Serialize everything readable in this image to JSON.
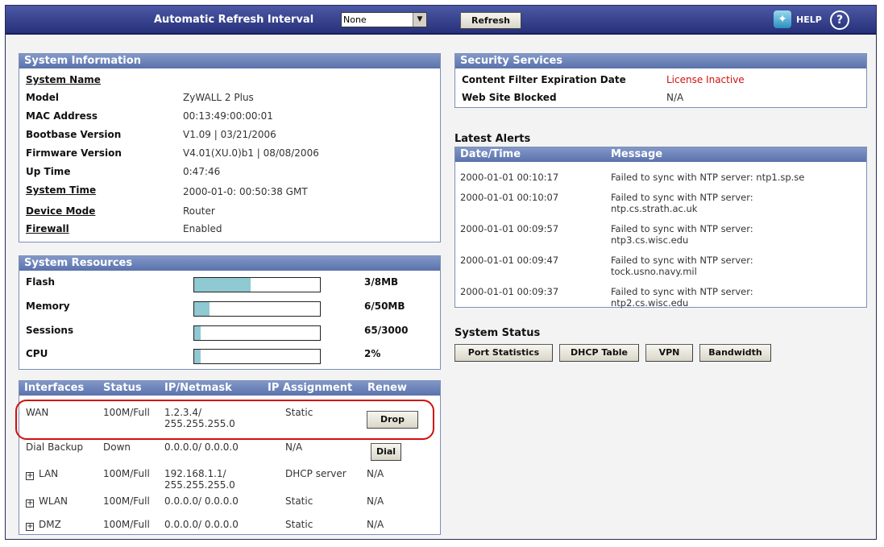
{
  "toolbar": {
    "refresh_interval_label": "Automatic Refresh Interval",
    "refresh_interval_value": "None",
    "refresh_button": "Refresh",
    "help_label": "HELP",
    "help_q": "?"
  },
  "system_information": {
    "title": "System Information",
    "rows": [
      {
        "label": "System Name",
        "value": ""
      },
      {
        "label": "Model",
        "value": "ZyWALL 2 Plus"
      },
      {
        "label": "MAC Address",
        "value": "00:13:49:00:00:01"
      },
      {
        "label": "Bootbase Version",
        "value": "V1.09 | 03/21/2006"
      },
      {
        "label": "Firmware Version",
        "value": "V4.01(XU.0)b1 | 08/08/2006"
      },
      {
        "label": "Up Time",
        "value": "0:47:46"
      },
      {
        "label": "System Time",
        "value": "2000-01-0: 00:50:38 GMT"
      },
      {
        "label": "Device Mode",
        "value": "Router"
      },
      {
        "label": "Firewall",
        "value": "Enabled"
      }
    ]
  },
  "system_resources": {
    "title": "System Resources",
    "rows": [
      {
        "label": "Flash",
        "value": "3/8MB",
        "fill": 0.45
      },
      {
        "label": "Memory",
        "value": "6/50MB",
        "fill": 0.12
      },
      {
        "label": "Sessions",
        "value": "65/3000",
        "fill": 0.05
      },
      {
        "label": "CPU",
        "value": "2%",
        "fill": 0.05
      }
    ]
  },
  "interfaces": {
    "headers": [
      "Interfaces",
      "Status",
      "IP/Netmask",
      "IP Assignment",
      "Renew"
    ],
    "rows": [
      {
        "name": "WAN",
        "status": "100M/Full",
        "ip": "1.2.3.4/",
        "mask": "255.255.255.0",
        "assign": "Static",
        "renew": "Drop"
      },
      {
        "name": "Dial Backup",
        "status": "Down",
        "ip": "0.0.0.0/ 0.0.0.0",
        "mask": "",
        "assign": "N/A",
        "renew": "Dial"
      },
      {
        "name": "LAN",
        "status": "100M/Full",
        "ip": "192.168.1.1/",
        "mask": "255.255.255.0",
        "assign": "DHCP server",
        "renew": "N/A"
      },
      {
        "name": "WLAN",
        "status": "100M/Full",
        "ip": "0.0.0.0/ 0.0.0.0",
        "mask": "",
        "assign": "Static",
        "renew": "N/A"
      },
      {
        "name": "DMZ",
        "status": "100M/Full",
        "ip": "0.0.0.0/ 0.0.0.0",
        "mask": "",
        "assign": "Static",
        "renew": "N/A"
      }
    ]
  },
  "security_services": {
    "title": "Security Services",
    "rows": [
      {
        "label": "Content Filter Expiration Date",
        "value": "License Inactive"
      },
      {
        "label": "Web Site Blocked",
        "value": "N/A"
      }
    ]
  },
  "latest_alerts": {
    "title": "Latest Alerts",
    "headers": [
      "Date/Time",
      "Message"
    ],
    "rows": [
      {
        "time": "2000-01-01 00:10:17",
        "msg1": "Failed to sync with NTP server: ntp1.sp.se",
        "msg2": ""
      },
      {
        "time": "2000-01-01 00:10:07",
        "msg1": "Failed to sync with NTP server:",
        "msg2": "ntp.cs.strath.ac.uk"
      },
      {
        "time": "2000-01-01 00:09:57",
        "msg1": "Failed to sync with NTP server:",
        "msg2": "ntp3.cs.wisc.edu"
      },
      {
        "time": "2000-01-01 00:09:47",
        "msg1": "Failed to sync with NTP server:",
        "msg2": "tock.usno.navy.mil"
      },
      {
        "time": "2000-01-01 00:09:37",
        "msg1": "Failed to sync with NTP server:",
        "msg2": "ntp2.cs.wisc.edu"
      }
    ]
  },
  "system_status": {
    "title": "System Status",
    "buttons": [
      "Port Statistics",
      "DHCP Table",
      "VPN",
      "Bandwidth"
    ]
  },
  "colors": {
    "header_blue": "#27307a",
    "panel_head": "#5a72ac",
    "alert_red": "#d01010",
    "bar_fill": "#8fc9d2"
  }
}
